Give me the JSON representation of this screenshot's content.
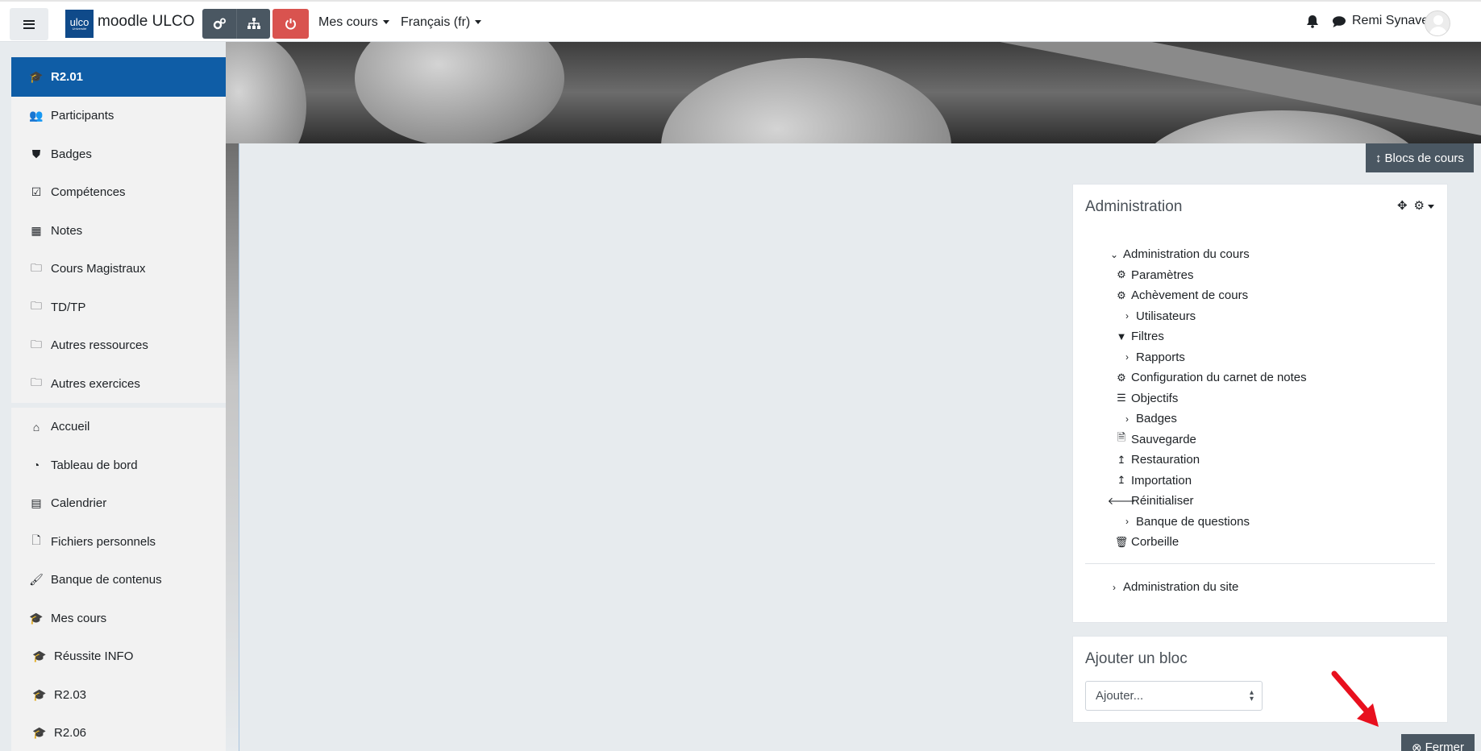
{
  "navbar": {
    "site_name": "moodle ULCO",
    "logo_text": "ulco",
    "logo_small": "Université",
    "menu_courses": "Mes cours",
    "menu_language": "Français (fr)",
    "user_name": "Remi Synave"
  },
  "sidebar": {
    "course_items": [
      {
        "label": "R2.01",
        "icon": "graduation-cap-icon"
      },
      {
        "label": "Participants",
        "icon": "users-icon"
      },
      {
        "label": "Badges",
        "icon": "shield-icon"
      },
      {
        "label": "Compétences",
        "icon": "check-square-icon"
      },
      {
        "label": "Notes",
        "icon": "table-icon"
      },
      {
        "label": "Cours Magistraux",
        "icon": "folder-icon"
      },
      {
        "label": "TD/TP",
        "icon": "folder-icon"
      },
      {
        "label": "Autres ressources",
        "icon": "folder-icon"
      },
      {
        "label": "Autres exercices",
        "icon": "folder-icon"
      }
    ],
    "site_items": [
      {
        "label": "Accueil",
        "icon": "home-icon"
      },
      {
        "label": "Tableau de bord",
        "icon": "dashboard-icon"
      },
      {
        "label": "Calendrier",
        "icon": "calendar-icon"
      },
      {
        "label": "Fichiers personnels",
        "icon": "file-icon"
      },
      {
        "label": "Banque de contenus",
        "icon": "paint-brush-icon"
      },
      {
        "label": "Mes cours",
        "icon": "graduation-cap-icon"
      },
      {
        "label": "Réussite INFO",
        "icon": "graduation-cap-icon"
      },
      {
        "label": "R2.03",
        "icon": "graduation-cap-icon"
      },
      {
        "label": "R2.06",
        "icon": "graduation-cap-icon"
      }
    ]
  },
  "main": {
    "blocks_button": "Blocs de cours",
    "close_button": "Fermer"
  },
  "admin_block": {
    "title": "Administration",
    "course_admin": "Administration du cours",
    "items": [
      {
        "label": "Paramètres",
        "icon": "gear-icon"
      },
      {
        "label": "Achèvement de cours",
        "icon": "gear-icon"
      },
      {
        "label": "Utilisateurs",
        "icon": "chevron-right-icon"
      },
      {
        "label": "Filtres",
        "icon": "filter-icon"
      },
      {
        "label": "Rapports",
        "icon": "chevron-right-icon"
      },
      {
        "label": "Configuration du carnet de notes",
        "icon": "gear-icon"
      },
      {
        "label": "Objectifs",
        "icon": "list-icon"
      },
      {
        "label": "Badges",
        "icon": "chevron-right-icon"
      },
      {
        "label": "Sauvegarde",
        "icon": "file-archive-icon"
      },
      {
        "label": "Restauration",
        "icon": "level-up-icon"
      },
      {
        "label": "Importation",
        "icon": "level-up-icon"
      },
      {
        "label": "Réinitialiser",
        "icon": "arrow-left-icon"
      },
      {
        "label": "Banque de questions",
        "icon": "chevron-right-icon"
      },
      {
        "label": "Corbeille",
        "icon": "trash-icon"
      }
    ],
    "site_admin": "Administration du site"
  },
  "add_block": {
    "title": "Ajouter un bloc",
    "select_value": "Ajouter..."
  },
  "colors": {
    "active_blue": "#0f5da6",
    "logout_red": "#d9534f",
    "toolbar_gray": "#4a5762",
    "annotation_arrow": "#e8101e"
  }
}
